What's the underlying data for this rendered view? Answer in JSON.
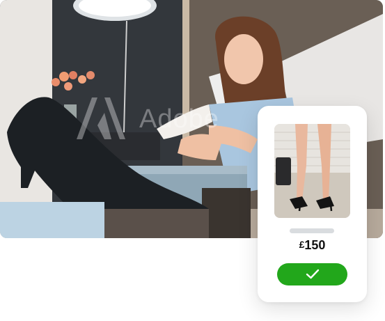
{
  "hero": {
    "watermark_text": "Adobe",
    "description_icon": "stock-photo"
  },
  "card": {
    "price_currency": "£",
    "price_amount": "150",
    "confirm_icon": "checkmark-icon",
    "confirm_color": "#22a71b",
    "placeholder_color": "#d9dcdf"
  }
}
